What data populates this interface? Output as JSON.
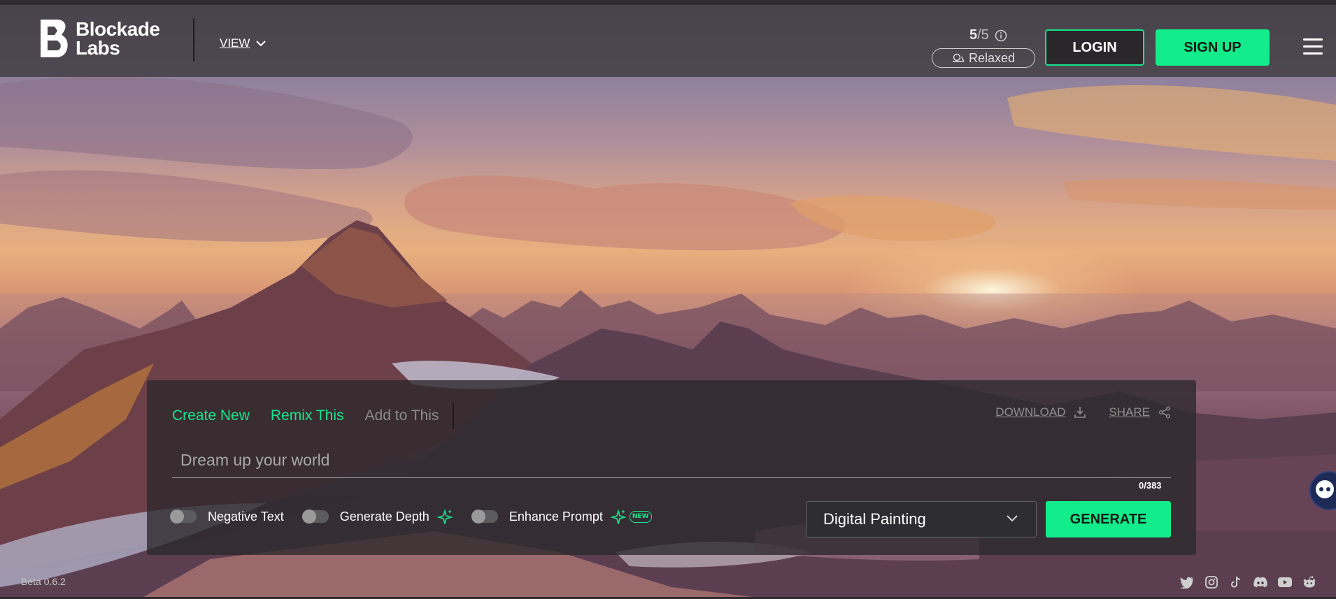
{
  "brand": {
    "name_line1": "Blockade",
    "name_line2": "Labs"
  },
  "nav": {
    "view_label": "VIEW"
  },
  "credits": {
    "used": "5",
    "total": "/5",
    "mode": "Relaxed"
  },
  "auth": {
    "login_label": "LOGIN",
    "signup_label": "SIGN UP"
  },
  "panel": {
    "tabs": [
      {
        "label": "Create New",
        "state": "active"
      },
      {
        "label": "Remix This",
        "state": "active"
      },
      {
        "label": "Add to This",
        "state": "disabled"
      }
    ],
    "download_label": "DOWNLOAD",
    "share_label": "SHARE",
    "prompt_placeholder": "Dream up your world",
    "prompt_value": "",
    "char_count": "0/383",
    "options": {
      "negative_text": {
        "label": "Negative Text",
        "enabled": false
      },
      "generate_depth": {
        "label": "Generate Depth",
        "enabled": false
      },
      "enhance_prompt": {
        "label": "Enhance Prompt",
        "enabled": false,
        "badge": "NEW"
      }
    },
    "style_selected": "Digital Painting",
    "generate_label": "GENERATE"
  },
  "footer": {
    "version": "Beta 0.6.2",
    "socials": [
      "twitter-icon",
      "instagram-icon",
      "tiktok-icon",
      "discord-icon",
      "youtube-icon",
      "reddit-icon"
    ]
  },
  "colors": {
    "accent": "#13ec8b",
    "header_bg": "#3e393c",
    "panel_bg": "#2a282c"
  }
}
